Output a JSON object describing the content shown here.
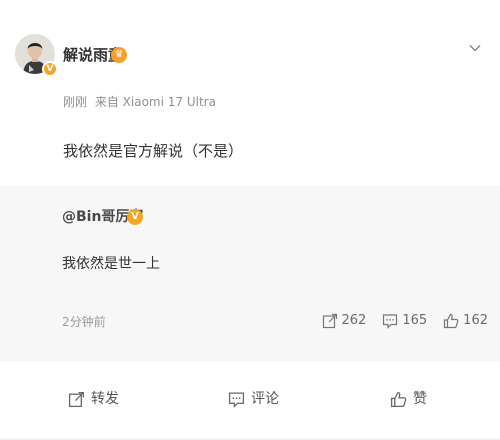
{
  "post": {
    "author": "解说雨童",
    "meta_time": "刚刚",
    "meta_source": "来自 Xiaomi 17 Ultra",
    "text": "我依然是官方解说（不是）"
  },
  "repost": {
    "author": "@Bin哥厉害",
    "text": "我依然是世一上",
    "time": "2分钟前",
    "stats": {
      "shares": "262",
      "comments": "165",
      "likes": "162"
    }
  },
  "actions": {
    "repost_label": "转发",
    "comment_label": "评论",
    "like_label": "赞"
  },
  "icons": {
    "more": "chevron-down-icon",
    "share": "share-icon",
    "comment": "comment-icon",
    "like": "thumbs-up-icon",
    "verified": "verified-badge-icon",
    "vip": "vip-crown-icon"
  },
  "colors": {
    "accent_orange": "#f5a623",
    "text_primary": "#333333",
    "text_secondary": "#8f8f8f"
  }
}
